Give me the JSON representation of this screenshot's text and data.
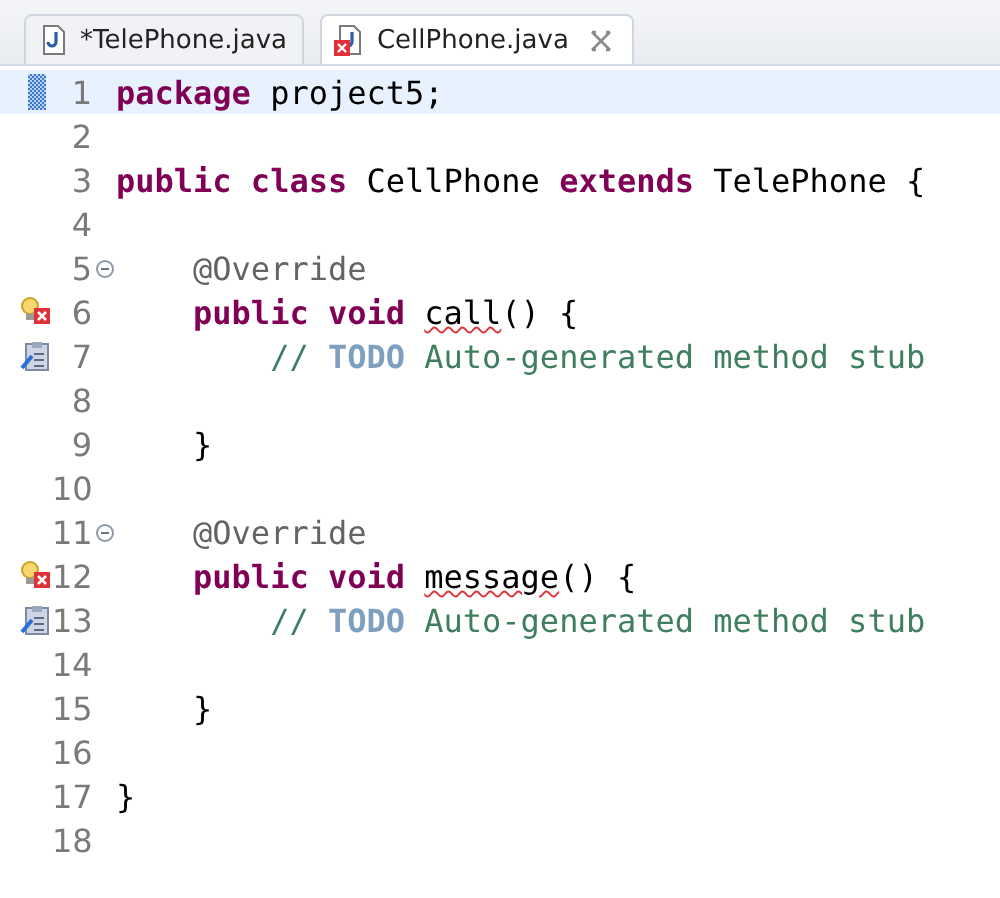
{
  "tabs": [
    {
      "label": "*TelePhone.java",
      "selected": false,
      "has_error": false
    },
    {
      "label": "CellPhone.java",
      "selected": true,
      "has_error": true
    }
  ],
  "lines": [
    {
      "number": "1",
      "current": true,
      "marker": {
        "kind": "range"
      },
      "fold": false,
      "tokens": [
        {
          "kind": "keyword",
          "text": "package"
        },
        {
          "kind": "plain",
          "text": " project5;"
        }
      ]
    },
    {
      "number": "2",
      "current": false,
      "fold": false
    },
    {
      "number": "3",
      "current": false,
      "fold": false,
      "tokens": [
        {
          "kind": "keyword",
          "text": "public class"
        },
        {
          "kind": "plain",
          "text": " CellPhone "
        },
        {
          "kind": "keyword",
          "text": "extends"
        },
        {
          "kind": "plain",
          "text": " TelePhone {"
        }
      ]
    },
    {
      "number": "4",
      "current": false,
      "fold": false
    },
    {
      "number": "5",
      "current": false,
      "fold": true,
      "tokens": [
        {
          "kind": "annotation",
          "text": "    @Override"
        }
      ]
    },
    {
      "number": "6",
      "current": false,
      "marker": {
        "kind": "error"
      },
      "fold": false,
      "tokens": [
        {
          "kind": "keyword",
          "text": "    public void "
        },
        {
          "kind": "error",
          "text": "call"
        },
        {
          "kind": "plain",
          "text": "() {"
        }
      ]
    },
    {
      "number": "7",
      "current": false,
      "marker": {
        "kind": "task"
      },
      "fold": false,
      "tokens": [
        {
          "kind": "comment",
          "text": "        // "
        },
        {
          "kind": "todo",
          "text": "TODO"
        },
        {
          "kind": "comment",
          "text": " Auto-generated method stub"
        }
      ]
    },
    {
      "number": "8",
      "current": false,
      "fold": false
    },
    {
      "number": "9",
      "current": false,
      "fold": false,
      "tokens": [
        {
          "kind": "plain",
          "text": "    }"
        }
      ]
    },
    {
      "number": "10",
      "current": false,
      "fold": false
    },
    {
      "number": "11",
      "current": false,
      "fold": true,
      "tokens": [
        {
          "kind": "annotation",
          "text": "    @Override"
        }
      ]
    },
    {
      "number": "12",
      "current": false,
      "marker": {
        "kind": "error"
      },
      "fold": false,
      "tokens": [
        {
          "kind": "keyword",
          "text": "    public void "
        },
        {
          "kind": "error",
          "text": "message"
        },
        {
          "kind": "plain",
          "text": "() {"
        }
      ]
    },
    {
      "number": "13",
      "current": false,
      "marker": {
        "kind": "task"
      },
      "fold": false,
      "tokens": [
        {
          "kind": "comment",
          "text": "        // "
        },
        {
          "kind": "todo",
          "text": "TODO"
        },
        {
          "kind": "comment",
          "text": " Auto-generated method stub"
        }
      ]
    },
    {
      "number": "14",
      "current": false,
      "fold": false
    },
    {
      "number": "15",
      "current": false,
      "fold": false,
      "tokens": [
        {
          "kind": "plain",
          "text": "    }"
        }
      ]
    },
    {
      "number": "16",
      "current": false,
      "fold": false
    },
    {
      "number": "17",
      "current": false,
      "fold": false,
      "tokens": [
        {
          "kind": "plain",
          "text": "}"
        }
      ]
    },
    {
      "number": "18",
      "current": false,
      "fold": false
    }
  ]
}
